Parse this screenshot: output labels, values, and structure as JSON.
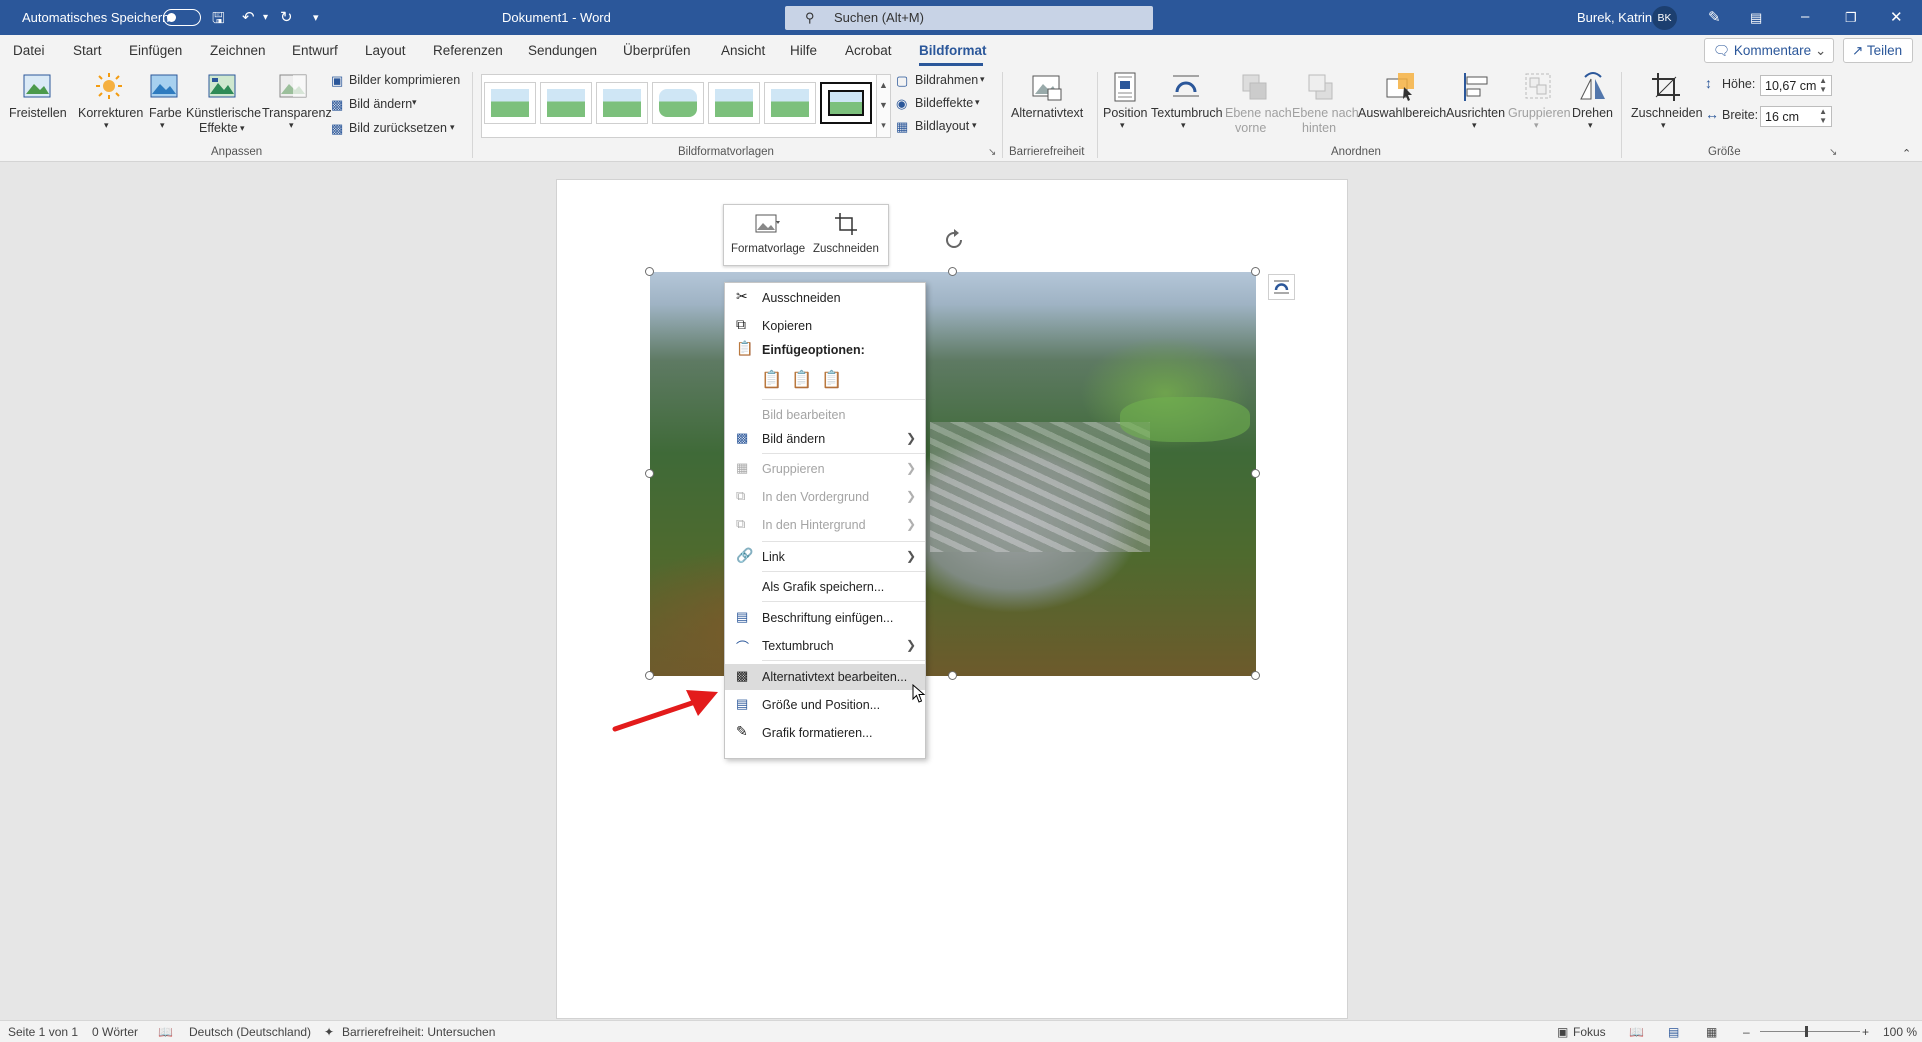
{
  "titlebar": {
    "autosave": "Automatisches Speichern",
    "doc_title": "Dokument1  -  Word",
    "search": "Suchen (Alt+M)",
    "user": "Burek, Katrin",
    "initials": "BK"
  },
  "tabs": [
    "Datei",
    "Start",
    "Einfügen",
    "Zeichnen",
    "Entwurf",
    "Layout",
    "Referenzen",
    "Sendungen",
    "Überprüfen",
    "Ansicht",
    "Hilfe",
    "Acrobat",
    "Bildformat"
  ],
  "active_tab": "Bildformat",
  "actions": {
    "comments": "Kommentare",
    "share": "Teilen"
  },
  "ribbon": {
    "freistellen": "Freistellen",
    "korrekturen": "Korrekturen",
    "farbe": "Farbe",
    "kuenstlerisch_1": "Künstlerische",
    "kuenstlerisch_2": "Effekte",
    "transparenz": "Transparenz",
    "komprimieren": "Bilder komprimieren",
    "bild_aendern": "Bild ändern",
    "zuruecksetzen": "Bild zurücksetzen",
    "bildrahmen": "Bildrahmen",
    "bildeffekte": "Bildeffekte",
    "bildlayout": "Bildlayout",
    "alternativtext": "Alternativtext",
    "position": "Position",
    "textumbruch": "Textumbruch",
    "ebene_vorne_1": "Ebene nach",
    "ebene_vorne_2": "vorne",
    "ebene_hinten_1": "Ebene nach",
    "ebene_hinten_2": "hinten",
    "auswahlbereich": "Auswahlbereich",
    "ausrichten": "Ausrichten",
    "gruppieren": "Gruppieren",
    "drehen": "Drehen",
    "zuschneiden": "Zuschneiden",
    "hoehe_label": "Höhe:",
    "hoehe_value": "10,67 cm",
    "breite_label": "Breite:",
    "breite_value": "16 cm",
    "groups": {
      "anpassen": "Anpassen",
      "vorlagen": "Bildformatvorlagen",
      "barriere": "Barrierefreiheit",
      "anordnen": "Anordnen",
      "groesse": "Größe"
    }
  },
  "minitoolbar": {
    "formatvorlage": "Formatvorlage",
    "zuschneiden": "Zuschneiden"
  },
  "context_menu": {
    "ausschneiden": "Ausschneiden",
    "kopieren": "Kopieren",
    "einfuegeoptionen": "Einfügeoptionen:",
    "bild_bearbeiten": "Bild bearbeiten",
    "bild_aendern": "Bild ändern",
    "gruppieren": "Gruppieren",
    "vordergrund": "In den Vordergrund",
    "hintergrund": "In den Hintergrund",
    "link": "Link",
    "als_grafik": "Als Grafik speichern...",
    "beschriftung": "Beschriftung einfügen...",
    "textumbruch": "Textumbruch",
    "alternativtext": "Alternativtext bearbeiten...",
    "groesse": "Größe und Position...",
    "grafik": "Grafik formatieren..."
  },
  "statusbar": {
    "page": "Seite 1 von 1",
    "words": "0 Wörter",
    "language": "Deutsch (Deutschland)",
    "accessibility": "Barrierefreiheit: Untersuchen",
    "focus": "Fokus",
    "zoom": "100 %"
  }
}
